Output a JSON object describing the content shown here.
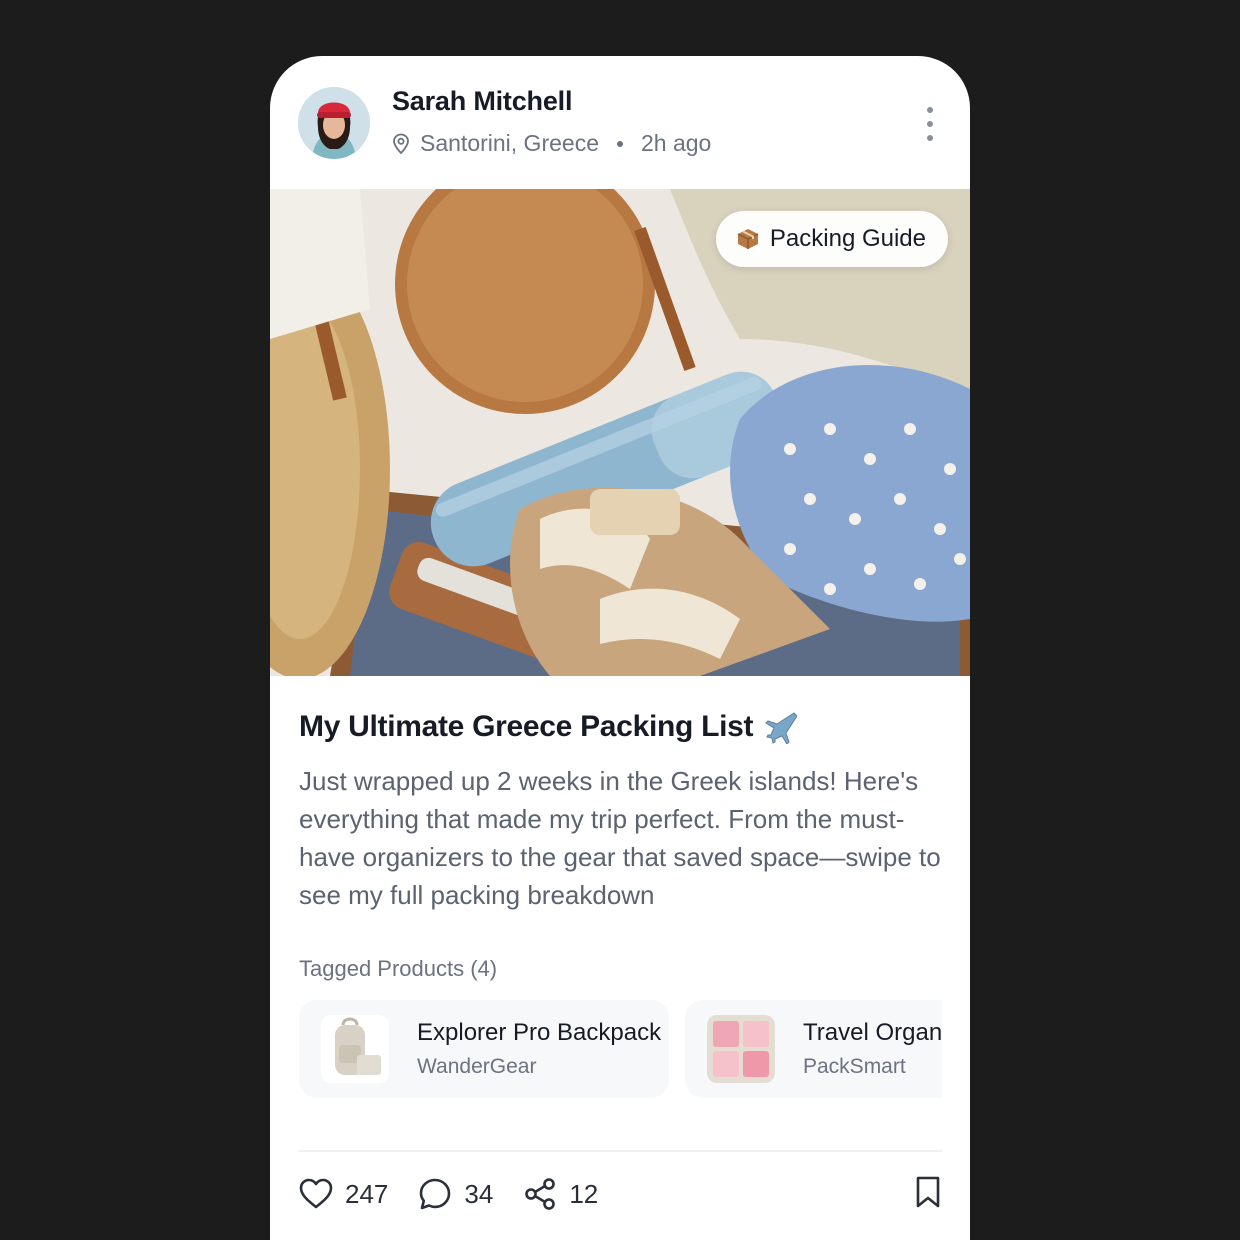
{
  "post": {
    "author": {
      "name": "Sarah Mitchell",
      "location": "Santorini, Greece",
      "time": "2h ago"
    },
    "badge": {
      "icon": "package-emoji",
      "label": "Packing Guide"
    },
    "title": "My Ultimate Greece Packing List",
    "title_icon": "airplane-emoji",
    "body": "Just wrapped up 2 weeks in the Greek islands! Here's everything that made my trip perfect. From the must-have organizers to the gear that saved space—swipe to see my full packing breakdown",
    "tagged_label": "Tagged Products (4)",
    "products": [
      {
        "name": "Explorer Pro Backpack",
        "brand": "WanderGear"
      },
      {
        "name": "Travel Organiz",
        "brand": "PackSmart"
      }
    ],
    "actions": {
      "likes": "247",
      "comments": "34",
      "shares": "12"
    }
  },
  "colors": {
    "background": "#1c1c1c",
    "card": "#ffffff",
    "text_primary": "#161b26",
    "text_secondary": "#6b7280"
  }
}
